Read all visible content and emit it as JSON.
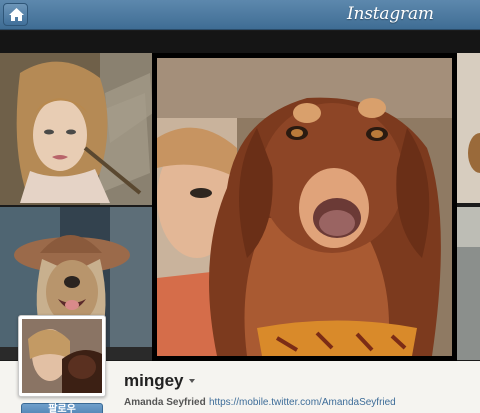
{
  "app": {
    "brand": "Instagram"
  },
  "icons": {
    "home": "home-icon",
    "user_menu": "chevron-down-icon"
  },
  "colors": {
    "topbar": "#4f7ca3",
    "link": "#3e6d99",
    "follow_button": "#5a8cbb"
  },
  "profile": {
    "username": "mingey",
    "full_name": "Amanda Seyfried",
    "website": "https://mobile.twitter.com/AmandaSeyfried",
    "follow_label": "팔로우"
  }
}
